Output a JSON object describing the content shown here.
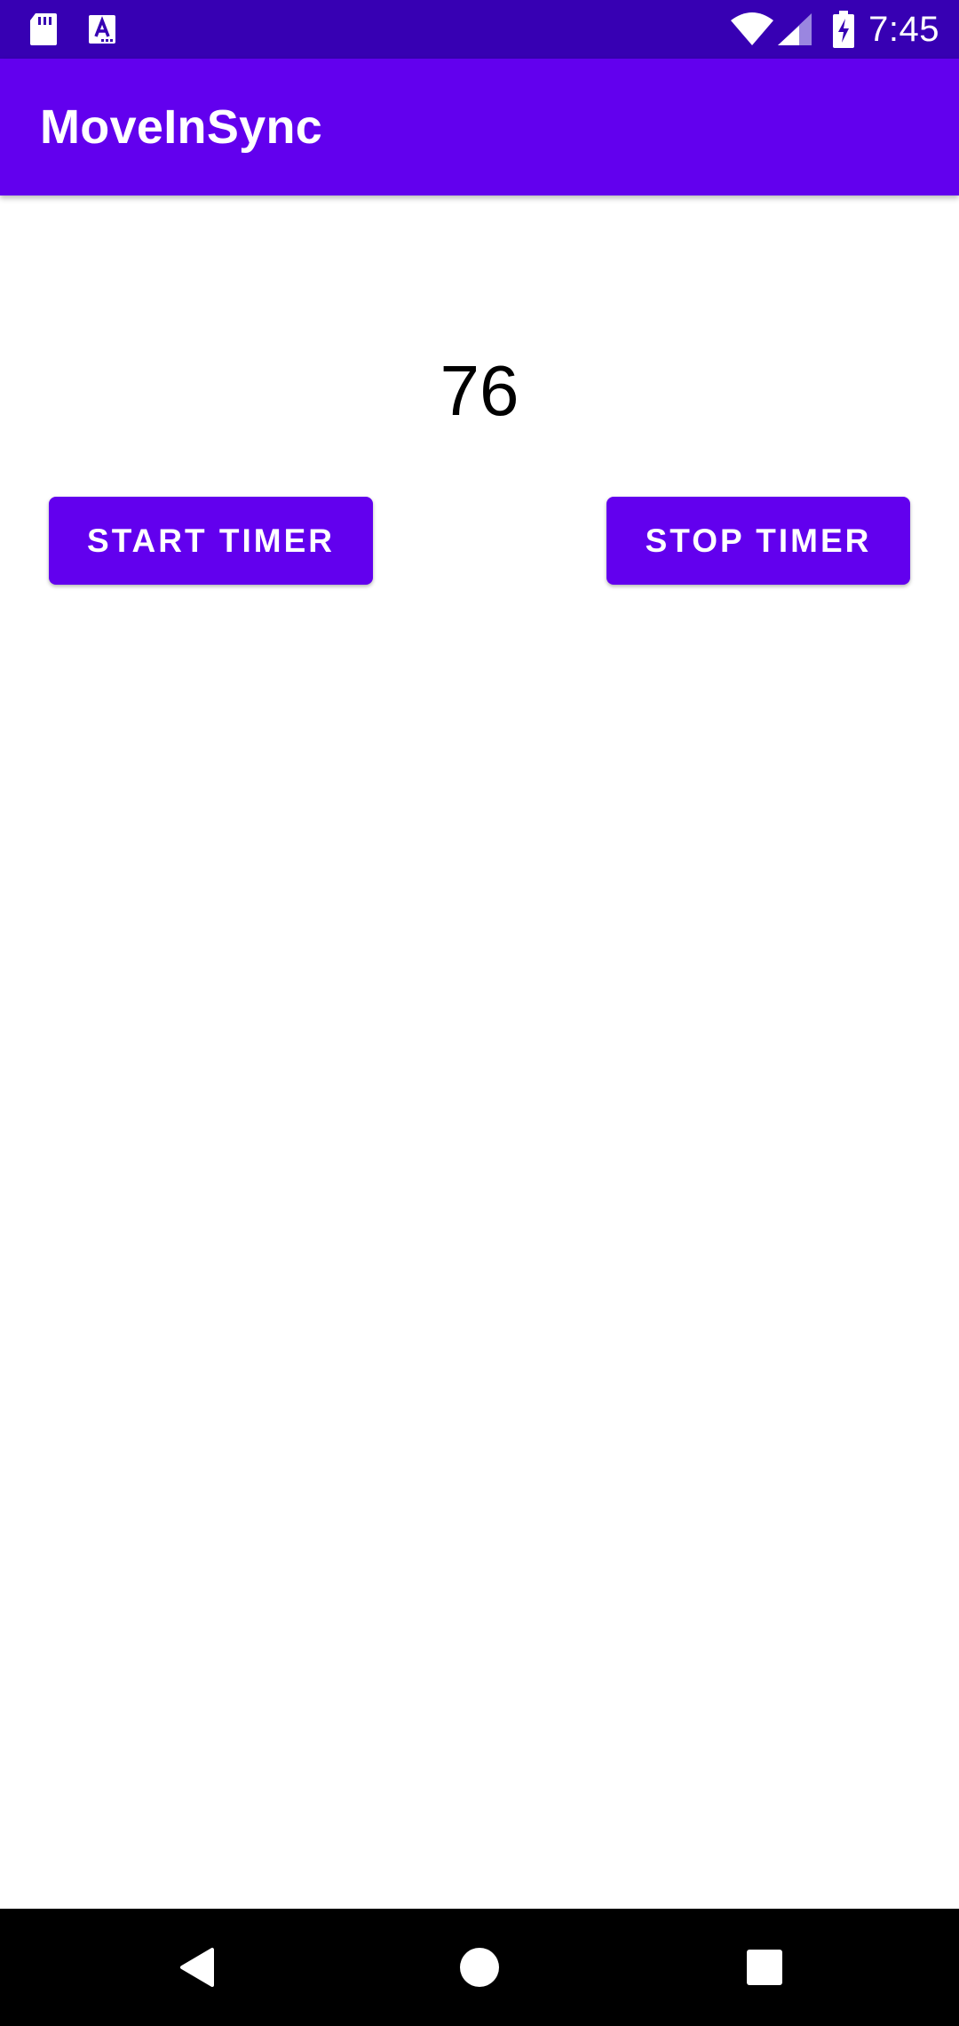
{
  "status_bar": {
    "time": "7:45",
    "icons": [
      "sd-card-icon",
      "font-a-icon",
      "wifi-icon",
      "signal-icon",
      "battery-charging-icon"
    ]
  },
  "app_bar": {
    "title": "MoveInSync",
    "color": "#6200EE",
    "status_bar_color": "#3700B3"
  },
  "main": {
    "timer_value": "76",
    "start_button_label": "START TIMER",
    "stop_button_label": "STOP TIMER",
    "button_color": "#6200EE"
  },
  "nav_bar": {
    "icons": [
      "back-icon",
      "home-icon",
      "recents-icon"
    ]
  }
}
